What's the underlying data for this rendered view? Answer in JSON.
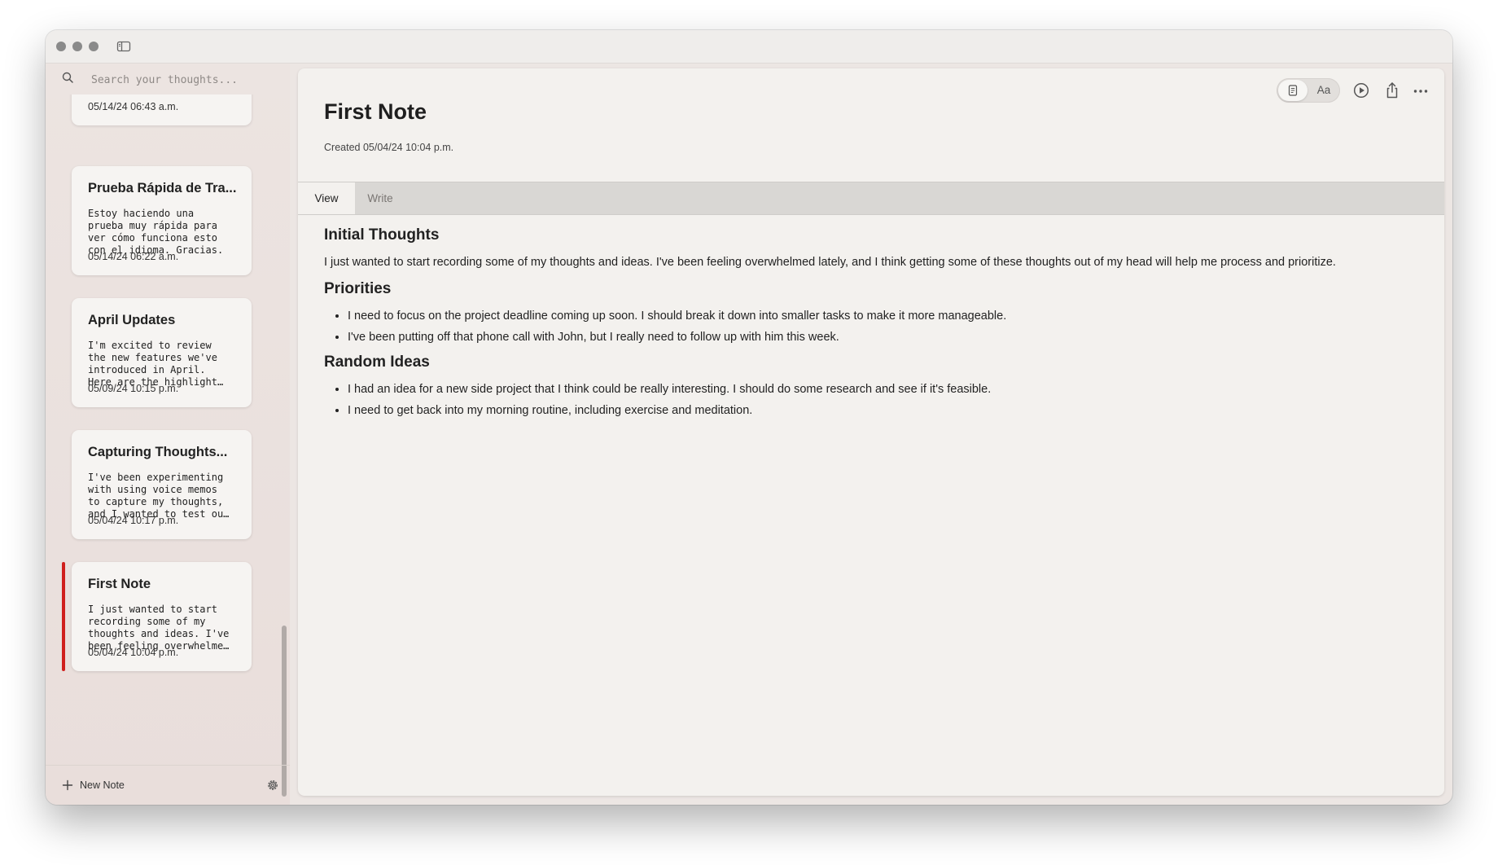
{
  "search": {
    "placeholder": "Search your thoughts..."
  },
  "notes": [
    {
      "title": "",
      "preview": "",
      "date": "05/14/24 06:43 a.m."
    },
    {
      "title": "Prueba Rápida de Tra...",
      "preview": "Estoy haciendo una\nprueba muy rápida para\nver cómo funciona esto\ncon el idioma. Gracias.",
      "date": "05/14/24 06:22 a.m."
    },
    {
      "title": "April Updates",
      "preview": "I'm excited to review\nthe new features we've\nintroduced in April.\nHere are the highlight…",
      "date": "05/09/24 10:15 p.m."
    },
    {
      "title": "Capturing Thoughts...",
      "preview": "I've been experimenting\nwith using voice memos\nto capture my thoughts,\nand I wanted to test ou…",
      "date": "05/04/24 10:17 p.m."
    },
    {
      "title": "First Note",
      "preview": "I just wanted to start\nrecording some of my\nthoughts and ideas. I've\nbeen feeling overwhelme…",
      "date": "05/04/24 10:04 p.m.",
      "selected": true
    }
  ],
  "footer": {
    "new_note_label": "New Note"
  },
  "note": {
    "title": "First Note",
    "created": "Created 05/04/24 10:04 p.m.",
    "tabs": [
      {
        "label": "View",
        "active": true
      },
      {
        "label": "Write",
        "active": false
      }
    ],
    "font_toggle_label": "Aa",
    "sections": [
      {
        "heading": "Initial Thoughts",
        "paragraph": "I just wanted to start recording some of my thoughts and ideas. I've been feeling overwhelmed lately, and I think getting some of these thoughts out of my head will help me process and prioritize."
      },
      {
        "heading": "Priorities",
        "bullets": [
          "I need to focus on the project deadline coming up soon. I should break it down into smaller tasks to make it more manageable.",
          "I've been putting off that phone call with John, but I really need to follow up with him this week."
        ]
      },
      {
        "heading": "Random Ideas",
        "bullets": [
          "I had an idea for a new side project that I think could be really interesting. I should do some research and see if it's feasible.",
          "I need to get back into my morning routine, including exercise and meditation."
        ]
      }
    ]
  },
  "icons": {
    "search": "search-icon",
    "sidebar_toggle": "sidebar-toggle-icon",
    "doc": "document-icon",
    "play": "play-icon",
    "share": "share-icon",
    "more": "more-icon",
    "plus": "plus-icon",
    "gear": "gear-icon"
  },
  "colors": {
    "selected_accent": "#d0201e"
  }
}
